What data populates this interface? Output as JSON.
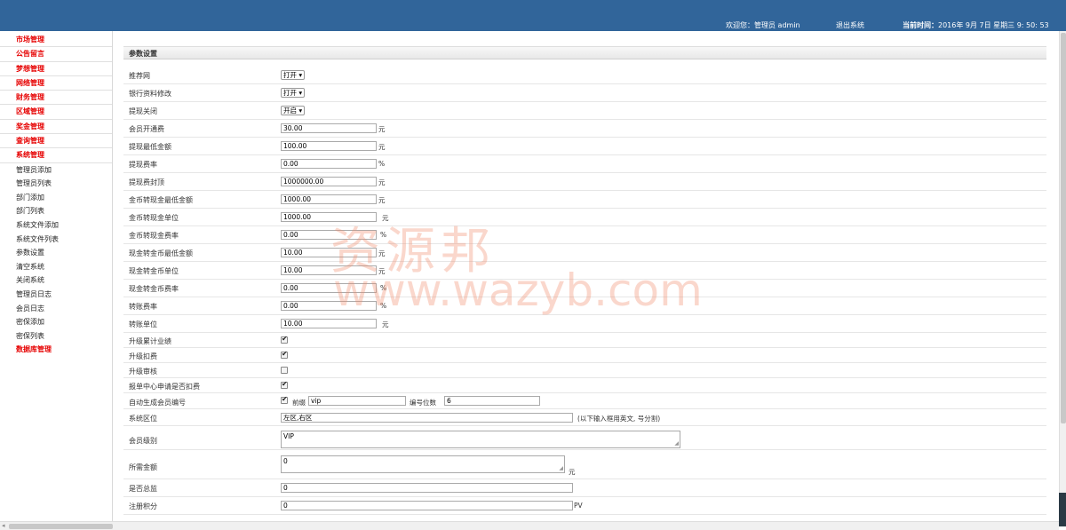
{
  "header": {
    "welcome": "欢迎您：管理员 admin",
    "logout": "退出系统",
    "time_label": "当前时间：",
    "time_value": "2016年 9月 7日 星期三 9: 50: 53"
  },
  "sidebar": {
    "categories": [
      "市场管理",
      "公告留言",
      "梦想管理",
      "网络管理",
      "财务管理",
      "区域管理",
      "奖金管理",
      "查询管理",
      "系统管理"
    ],
    "items": [
      "管理员添加",
      "管理员列表",
      "部门添加",
      "部门列表",
      "系统文件添加",
      "系统文件列表",
      "参数设置",
      "清空系统",
      "关闭系统",
      "管理员日志",
      "会员日志",
      "密保添加",
      "密保列表"
    ],
    "last_category": "数据库管理"
  },
  "panel": {
    "title": "参数设置"
  },
  "form": {
    "rows": [
      {
        "label": "推荐网",
        "select": "打开 ▾"
      },
      {
        "label": "银行资料修改",
        "select": "打开 ▾"
      },
      {
        "label": "提现关闭",
        "select": "开启 ▾"
      },
      {
        "label": "会员开通费",
        "value": "30.00",
        "unit": "元"
      },
      {
        "label": "提现最低金额",
        "value": "100.00",
        "unit": "元"
      },
      {
        "label": "提现费率",
        "value": "0.00",
        "unit": "%"
      },
      {
        "label": "提现费封顶",
        "value": "1000000.00",
        "unit": "元"
      },
      {
        "label": "金币转现金最低金额",
        "value": "1000.00",
        "unit": "元"
      },
      {
        "label": "金币转现金单位",
        "value": "1000.00",
        "unit": "元"
      },
      {
        "label": "金币转现金费率",
        "value": "0.00",
        "unit": "%"
      },
      {
        "label": "现金转金币最低金额",
        "value": "10.00",
        "unit": "元"
      },
      {
        "label": "现金转金币单位",
        "value": "10.00",
        "unit": "元"
      },
      {
        "label": "现金转金币费率",
        "value": "0.00",
        "unit": "%"
      },
      {
        "label": "转账费率",
        "value": "0.00",
        "unit": "%"
      },
      {
        "label": "转账单位",
        "value": "10.00",
        "unit": "元"
      },
      {
        "label": "升级累计业绩",
        "checked": true
      },
      {
        "label": "升级扣费",
        "checked": true
      },
      {
        "label": "升级审核",
        "checked": false
      },
      {
        "label": "报单中心申请是否扣费",
        "checked": true
      },
      {
        "label": "自动生成会员编号",
        "checked": true,
        "prefix_label": "前缀",
        "prefix_value": "vip",
        "digits_label": "编号位数",
        "digits_value": "6"
      },
      {
        "label": "系统区位",
        "value": "左区,右区",
        "hint": "(以下输入框用英文, 号分割)"
      },
      {
        "label": "会员级别",
        "area": "VIP"
      },
      {
        "label": "所需金额",
        "area": "0",
        "unit": "元"
      },
      {
        "label": "是否总监",
        "value": "0"
      },
      {
        "label": "注册积分",
        "value": "0",
        "unit": "PV"
      }
    ]
  },
  "watermark": {
    "line1": "资源邦",
    "line2": "www.wazyb.com"
  }
}
